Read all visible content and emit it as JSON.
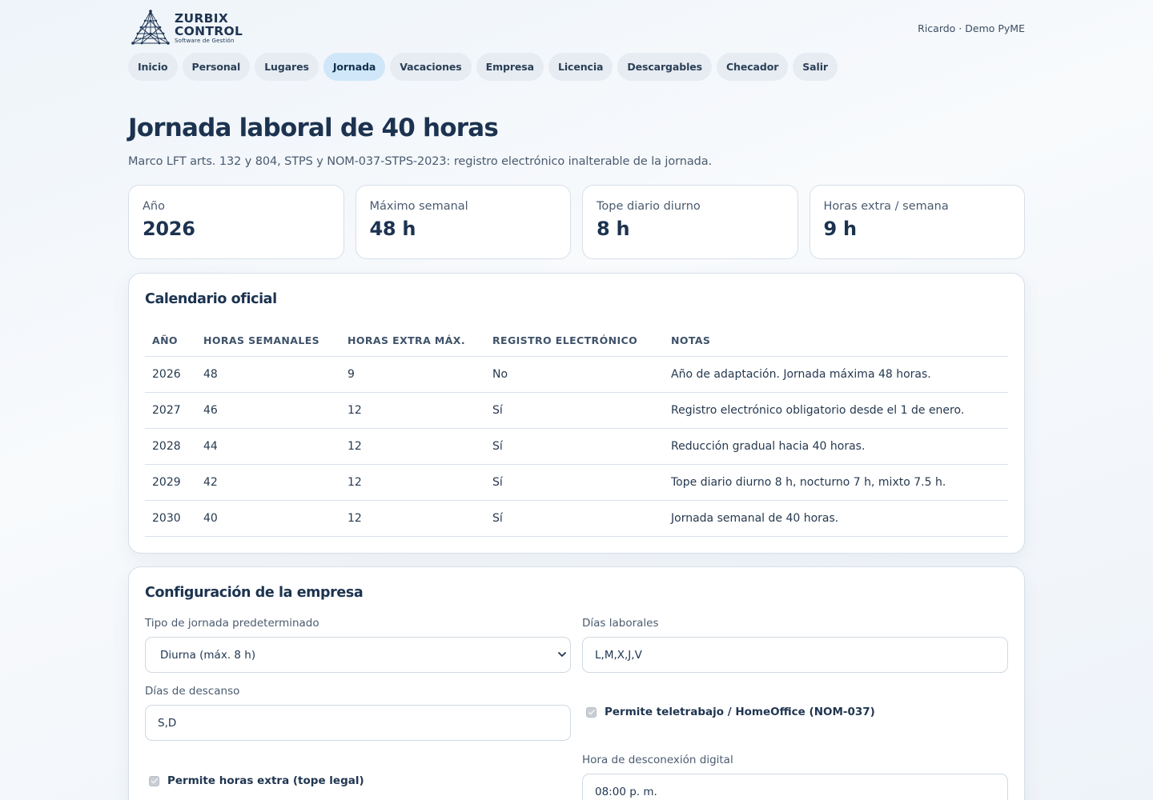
{
  "brand": {
    "line1": "ZURBIX",
    "line2": "CONTROL",
    "tagline": "Software de Gestión"
  },
  "user": "Ricardo · Demo PyME",
  "nav": [
    {
      "label": "Inicio",
      "active": false
    },
    {
      "label": "Personal",
      "active": false
    },
    {
      "label": "Lugares",
      "active": false
    },
    {
      "label": "Jornada",
      "active": true
    },
    {
      "label": "Vacaciones",
      "active": false
    },
    {
      "label": "Empresa",
      "active": false
    },
    {
      "label": "Licencia",
      "active": false
    },
    {
      "label": "Descargables",
      "active": false
    },
    {
      "label": "Checador",
      "active": false
    },
    {
      "label": "Salir",
      "active": false
    }
  ],
  "page": {
    "title": "Jornada laboral de 40 horas",
    "subtitle": "Marco LFT arts. 132 y 804, STPS y NOM-037-STPS-2023: registro electrónico inalterable de la jornada."
  },
  "stats": [
    {
      "label": "Año",
      "value": "2026"
    },
    {
      "label": "Máximo semanal",
      "value": "48 h"
    },
    {
      "label": "Tope diario diurno",
      "value": "8 h"
    },
    {
      "label": "Horas extra / semana",
      "value": "9 h"
    }
  ],
  "calendar": {
    "title": "Calendario oficial",
    "columns": [
      "AÑO",
      "HORAS SEMANALES",
      "HORAS EXTRA MÁX.",
      "REGISTRO ELECTRÓNICO",
      "NOTAS"
    ],
    "rows": [
      [
        "2026",
        "48",
        "9",
        "No",
        "Año de adaptación. Jornada máxima 48 horas."
      ],
      [
        "2027",
        "46",
        "12",
        "Sí",
        "Registro electrónico obligatorio desde el 1 de enero."
      ],
      [
        "2028",
        "44",
        "12",
        "Sí",
        "Reducción gradual hacia 40 horas."
      ],
      [
        "2029",
        "42",
        "12",
        "Sí",
        "Tope diario diurno 8 h, nocturno 7 h, mixto 7.5 h."
      ],
      [
        "2030",
        "40",
        "12",
        "Sí",
        "Jornada semanal de 40 horas."
      ]
    ]
  },
  "config": {
    "title": "Configuración de la empresa",
    "tipo_label": "Tipo de jornada predeterminado",
    "tipo_value": "Diurna (máx. 8 h)",
    "dias_laborales_label": "Días laborales",
    "dias_laborales_value": "L,M,X,J,V",
    "dias_descanso_label": "Días de descanso",
    "dias_descanso_value": "S,D",
    "teletrabajo_label": "Permite teletrabajo / HomeOffice (NOM-037)",
    "horas_extra_label": "Permite horas extra (tope legal)",
    "desconexion_label": "Hora de desconexión digital",
    "desconexion_value": "08:00 p. m."
  },
  "colors": {
    "accent_pill": "#cfe7f9",
    "text_dark": "#1c3350"
  }
}
